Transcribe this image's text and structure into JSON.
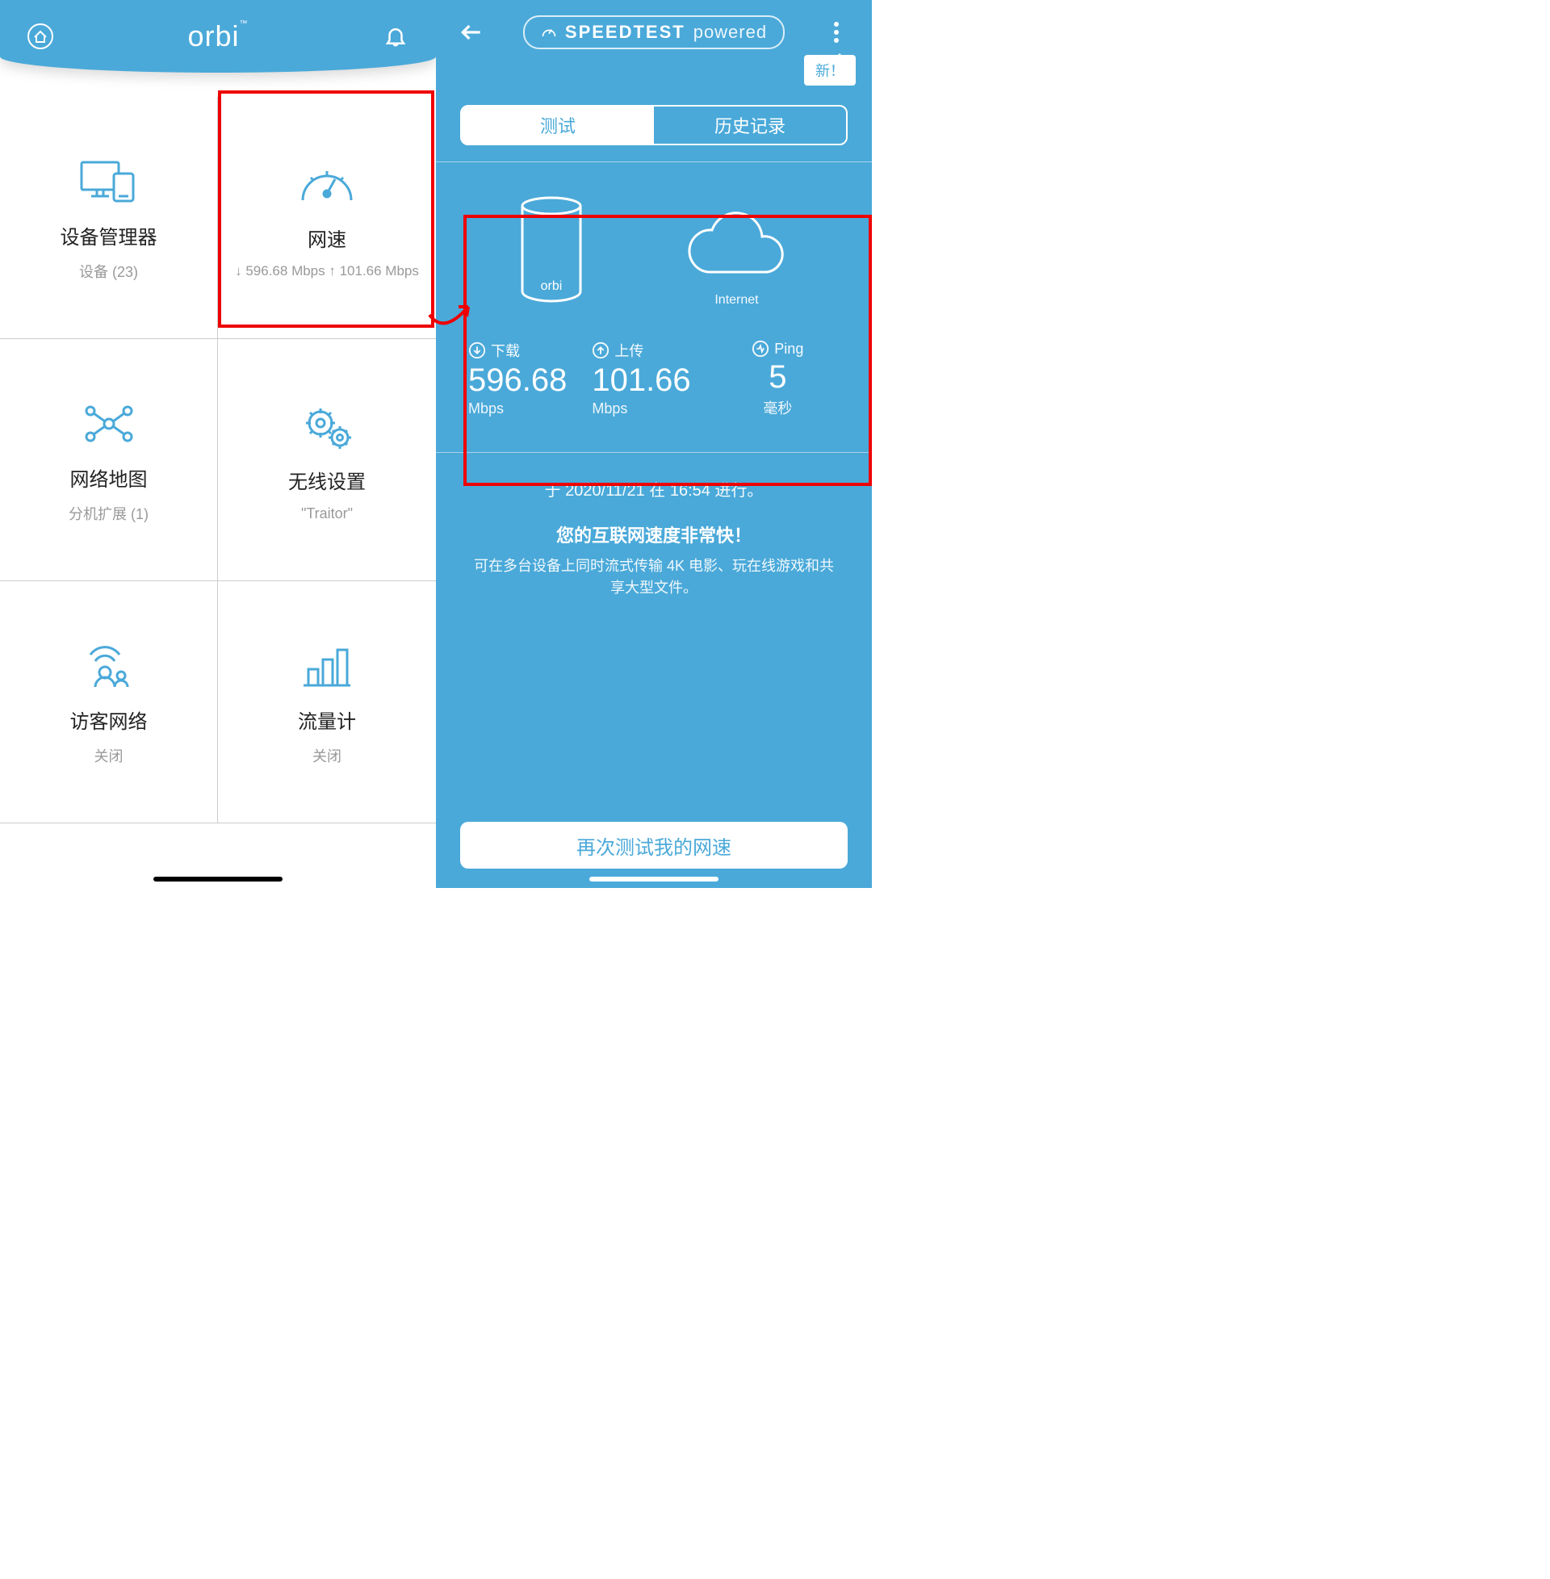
{
  "colors": {
    "accent": "#4aa9d9",
    "highlight": "#e00000"
  },
  "left": {
    "brand": "orbi",
    "tiles": {
      "device_manager": {
        "title": "设备管理器",
        "sub": "设备  (23)"
      },
      "speed": {
        "title": "网速",
        "sub": "↓ 596.68 Mbps ↑ 101.66 Mbps"
      },
      "network_map": {
        "title": "网络地图",
        "sub": "分机扩展 (1)"
      },
      "wifi": {
        "title": "无线设置",
        "sub": "\"Traitor\""
      },
      "guest": {
        "title": "访客网络",
        "sub": "关闭"
      },
      "traffic": {
        "title": "流量计",
        "sub": "关闭"
      }
    }
  },
  "right": {
    "speedtest_label": "SPEEDTEST",
    "speedtest_powered": "powered",
    "new_badge": "新！",
    "tabs": {
      "test": "测试",
      "history": "历史记录"
    },
    "internet_label": "Internet",
    "orbi_label": "orbi",
    "download": {
      "label": "下载",
      "value": "596.68",
      "unit": "Mbps"
    },
    "upload": {
      "label": "上传",
      "value": "101.66",
      "unit": "Mbps"
    },
    "ping": {
      "label": "Ping",
      "value": "5",
      "unit": "毫秒"
    },
    "timestamp": "于 2020/11/21 在 16:54 进行。",
    "headline": "您的互联网速度非常快！",
    "desc": "可在多台设备上同时流式传输 4K 电影、玩在线游戏和共享大型文件。",
    "retest": "再次测试我的网速"
  }
}
